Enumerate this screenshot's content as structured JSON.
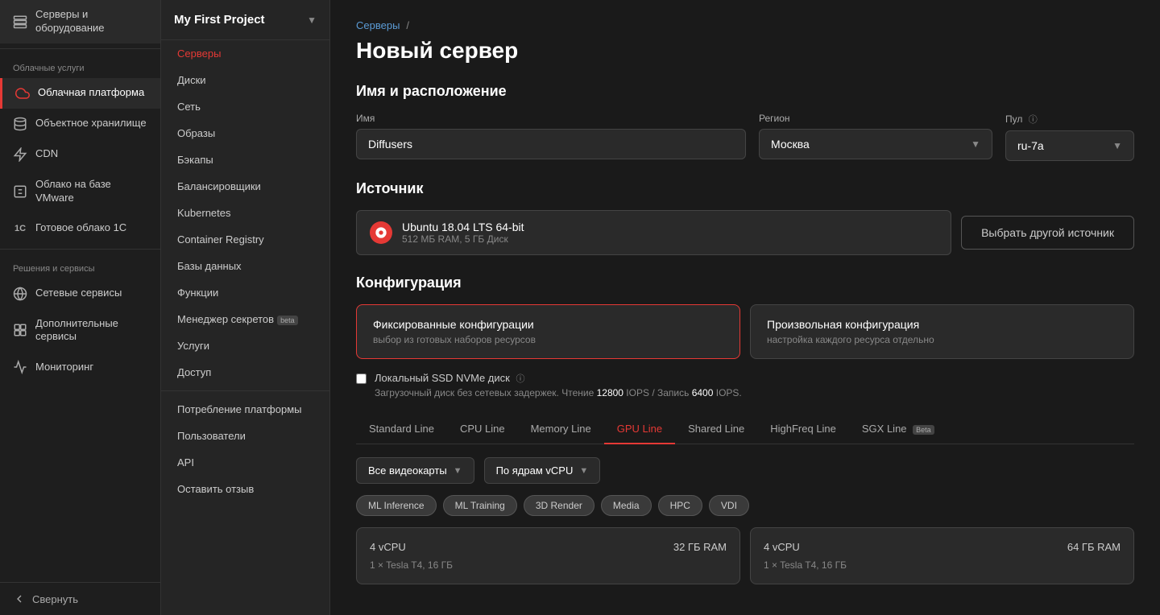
{
  "sidebar": {
    "sections": [
      {
        "label": "",
        "items": [
          {
            "id": "servers-hardware",
            "label": "Серверы и оборудование",
            "icon": "⬜",
            "active": false
          },
          {
            "id": "divider1",
            "type": "divider"
          },
          {
            "id": "section-cloud",
            "label": "Облачные услуги",
            "type": "section"
          },
          {
            "id": "cloud-platform",
            "label": "Облачная платформа",
            "icon": "☁",
            "active": true
          },
          {
            "id": "object-storage",
            "label": "Объектное хранилище",
            "icon": "🗄",
            "active": false
          },
          {
            "id": "cdn",
            "label": "CDN",
            "icon": "⚡",
            "active": false
          },
          {
            "id": "vmware",
            "label": "Облако на базе VMware",
            "icon": "🔲",
            "active": false
          },
          {
            "id": "1c-cloud",
            "label": "Готовое облако 1С",
            "icon": "1C",
            "active": false
          },
          {
            "id": "divider2",
            "type": "divider"
          },
          {
            "id": "section-solutions",
            "label": "Решения и сервисы",
            "type": "section"
          },
          {
            "id": "network-services",
            "label": "Сетевые сервисы",
            "icon": "🌐",
            "active": false
          },
          {
            "id": "extra-services",
            "label": "Дополнительные сервисы",
            "icon": "➕",
            "active": false
          },
          {
            "id": "monitoring",
            "label": "Мониторинг",
            "icon": "📊",
            "active": false
          }
        ]
      }
    ],
    "collapse_label": "Свернуть"
  },
  "project": {
    "title": "My First Project",
    "nav_items": [
      {
        "id": "servers",
        "label": "Серверы",
        "active": true
      },
      {
        "id": "disks",
        "label": "Диски",
        "active": false
      },
      {
        "id": "network",
        "label": "Сеть",
        "active": false
      },
      {
        "id": "images",
        "label": "Образы",
        "active": false
      },
      {
        "id": "backups",
        "label": "Бэкапы",
        "active": false
      },
      {
        "id": "balancers",
        "label": "Балансировщики",
        "active": false
      },
      {
        "id": "kubernetes",
        "label": "Kubernetes",
        "active": false
      },
      {
        "id": "container-registry",
        "label": "Container Registry",
        "active": false
      },
      {
        "id": "databases",
        "label": "Базы данных",
        "active": false
      },
      {
        "id": "functions",
        "label": "Функции",
        "active": false
      },
      {
        "id": "secrets",
        "label": "Менеджер секретов",
        "active": false,
        "badge": "beta"
      },
      {
        "id": "services",
        "label": "Услуги",
        "active": false
      },
      {
        "id": "access",
        "label": "Доступ",
        "active": false
      }
    ],
    "bottom_items": [
      {
        "id": "consumption",
        "label": "Потребление платформы"
      },
      {
        "id": "users",
        "label": "Пользователи"
      },
      {
        "id": "api",
        "label": "API"
      },
      {
        "id": "feedback",
        "label": "Оставить отзыв"
      }
    ]
  },
  "main": {
    "breadcrumb": {
      "link_label": "Серверы",
      "separator": "/"
    },
    "page_title": "Новый сервер",
    "name_location_section": "Имя и расположение",
    "name_label": "Имя",
    "name_value": "Diffusers",
    "region_label": "Регион",
    "region_value": "Москва",
    "pool_label": "Пул",
    "pool_value": "ru-7a",
    "source_section": "Источник",
    "source_os": "Ubuntu 18.04 LTS 64-bit",
    "source_meta": "512 МБ RAM, 5 ГБ Диск",
    "source_btn": "Выбрать другой источник",
    "config_section": "Конфигурация",
    "config_fixed_title": "Фиксированные конфигурации",
    "config_fixed_desc": "выбор из готовых наборов ресурсов",
    "config_custom_title": "Произвольная конфигурация",
    "config_custom_desc": "настройка каждого ресурса отдельно",
    "nvme_label": "Локальный SSD NVMe диск",
    "nvme_desc": "Загрузочный диск без сетевых задержек. Чтение 12800 IOPS / Запись 6400 IOPS.",
    "nvme_read": "12800",
    "nvme_write": "6400",
    "tabs": [
      {
        "id": "standard",
        "label": "Standard Line",
        "active": false
      },
      {
        "id": "cpu",
        "label": "CPU Line",
        "active": false
      },
      {
        "id": "memory",
        "label": "Memory Line",
        "active": false
      },
      {
        "id": "gpu",
        "label": "GPU Line",
        "active": true
      },
      {
        "id": "shared",
        "label": "Shared Line",
        "active": false
      },
      {
        "id": "highfreq",
        "label": "HighFreq Line",
        "active": false
      },
      {
        "id": "sgx",
        "label": "SGX Line",
        "active": false,
        "badge": "Beta"
      }
    ],
    "filter_gpu_placeholder": "Все видеокарты",
    "filter_sort_placeholder": "По ядрам vCPU",
    "filter_tags": [
      {
        "id": "ml-inference",
        "label": "ML Inference",
        "active": false
      },
      {
        "id": "ml-training",
        "label": "ML Training",
        "active": false
      },
      {
        "id": "3d-render",
        "label": "3D Render",
        "active": false
      },
      {
        "id": "media",
        "label": "Media",
        "active": false
      },
      {
        "id": "hpc",
        "label": "HPC",
        "active": false
      },
      {
        "id": "vdi",
        "label": "VDI",
        "active": false
      }
    ],
    "server_cards": [
      {
        "vcpu": "4 vCPU",
        "gpu": "1 × Tesla T4, 16 ГБ",
        "ram": "32 ГБ RAM"
      },
      {
        "vcpu": "4 vCPU",
        "gpu": "1 × Tesla T4, 16 ГБ",
        "ram": "64 ГБ RAM"
      }
    ]
  },
  "colors": {
    "accent": "#e53935",
    "link": "#5b9bd5"
  }
}
